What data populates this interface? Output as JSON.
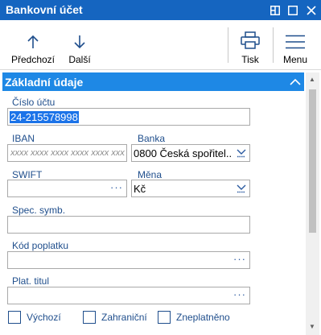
{
  "window": {
    "title": "Bankovní účet",
    "accent": "#1565c0"
  },
  "toolbar": {
    "previous_label": "Předchozí",
    "next_label": "Další",
    "print_label": "Tisk",
    "menu_label": "Menu"
  },
  "section": {
    "title": "Základní údaje",
    "accent": "#1e88e5"
  },
  "fields": {
    "account_number": {
      "label": "Číslo účtu",
      "value": "24-215578998"
    },
    "iban": {
      "label": "IBAN",
      "placeholder": "xxxx xxxx xxxx xxxx xxxx xxxx"
    },
    "bank": {
      "label": "Banka",
      "value": "0800 Česká spořitel..."
    },
    "swift": {
      "label": "SWIFT",
      "value": ""
    },
    "currency": {
      "label": "Měna",
      "value": "Kč"
    },
    "spec_symbol": {
      "label": "Spec. symb.",
      "value": ""
    },
    "fee_code": {
      "label": "Kód poplatku",
      "value": ""
    },
    "payment_title": {
      "label": "Plat. titul",
      "value": ""
    }
  },
  "checkboxes": {
    "default": {
      "label": "Výchozí",
      "checked": false
    },
    "foreign": {
      "label": "Zahraniční",
      "checked": false
    },
    "invalidated": {
      "label": "Zneplatněno",
      "checked": false
    }
  }
}
